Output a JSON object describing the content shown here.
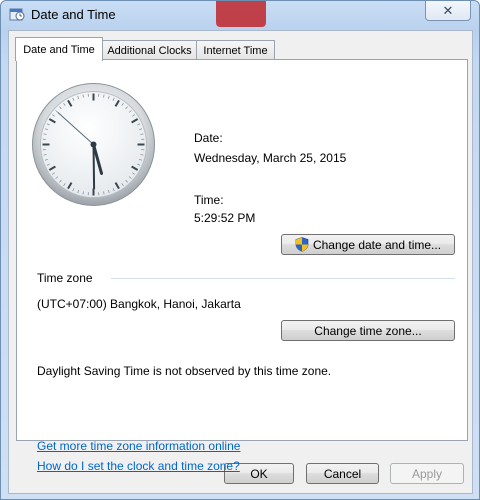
{
  "window": {
    "title": "Date and Time",
    "close_label": "✕",
    "icon": "calendar-clock-icon"
  },
  "tabs": [
    {
      "label": "Date and Time",
      "active": true
    },
    {
      "label": "Additional Clocks",
      "active": false
    },
    {
      "label": "Internet Time",
      "active": false
    }
  ],
  "datetime": {
    "date_label": "Date:",
    "date_value": "Wednesday, March 25, 2015",
    "time_label": "Time:",
    "time_value": "5:29:52 PM",
    "change_datetime_button": "Change date and time...",
    "change_datetime_icon": "uac-shield-icon"
  },
  "timezone": {
    "section_label": "Time zone",
    "value": "(UTC+07:00) Bangkok, Hanoi, Jakarta",
    "change_button": "Change time zone...",
    "dst_note": "Daylight Saving Time is not observed by this time zone."
  },
  "links": {
    "more_info": "Get more time zone information online",
    "how_to_set": "How do I set the clock and time zone?"
  },
  "footer": {
    "ok": "OK",
    "cancel": "Cancel",
    "apply": "Apply"
  },
  "clock": {
    "hours": 5,
    "minutes": 29,
    "seconds": 52
  },
  "colors": {
    "link": "#0066cc",
    "title_bar": "#c9def5",
    "background_deco": "#c0262c"
  }
}
